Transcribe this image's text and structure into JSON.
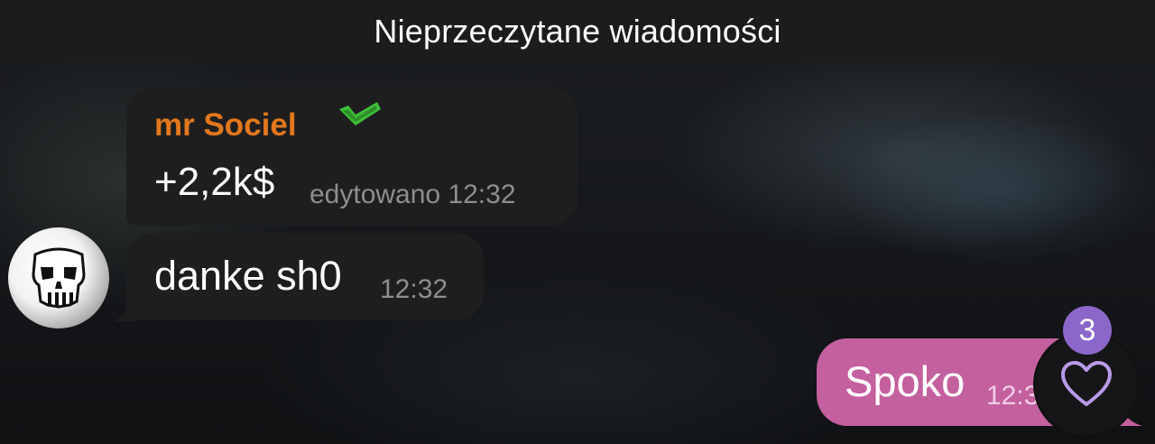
{
  "header": {
    "title": "Nieprzeczytane wiadomości"
  },
  "messages": [
    {
      "sender": "mr Sociel",
      "text": "+2,2k$",
      "meta": "edytowano 12:32"
    },
    {
      "text": "danke sh0",
      "time": "12:32"
    },
    {
      "text": "Spoko",
      "time": "12:32",
      "reaction_count": "3",
      "reaction_icon": "heart-icon"
    }
  ],
  "colors": {
    "sender_name": "#e2771d",
    "incoming_bubble": "#1e1e1f",
    "outgoing_bubble": "#c4609e",
    "reaction_badge": "#8b67c9",
    "heart": "#b79be8",
    "verified_check": "#3fbf3a"
  }
}
